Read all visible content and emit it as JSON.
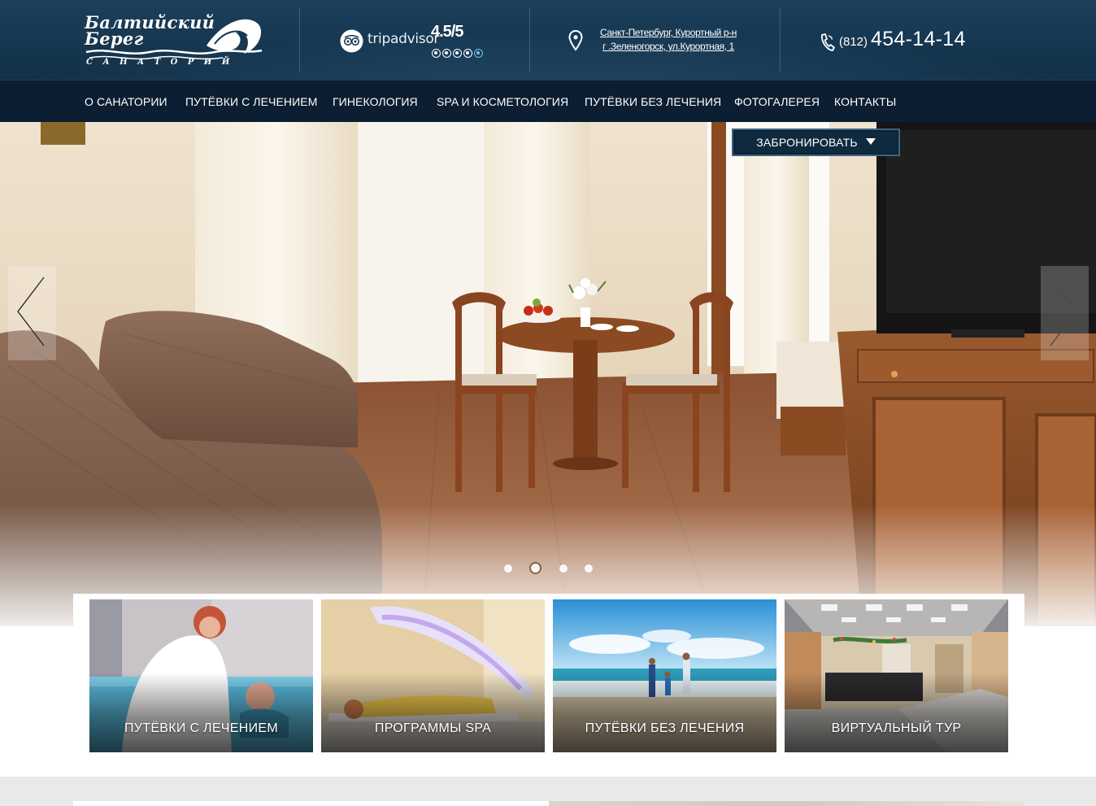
{
  "header": {
    "logo": {
      "title": "Балтийский Берег",
      "subtitle": "САНАТОРИЙ"
    },
    "tripadvisor": {
      "name": "tripadvisor",
      "rating": "4.5/5",
      "score": 4.5,
      "icon": "tripadvisor-owl-icon"
    },
    "address": {
      "line1": "Санкт-Петербург, Курортный р-н",
      "line2": "г .Зеленогорск, ул.Курортная, 1",
      "icon": "map-pin-icon"
    },
    "phone": {
      "code": "(812)",
      "number": "454-14-14",
      "icon": "phone-icon"
    }
  },
  "nav": {
    "items": [
      "О САНАТОРИИ",
      "ПУТЁВКИ С ЛЕЧЕНИЕМ",
      "ГИНЕКОЛОГИЯ",
      "SPA И КОСМЕТОЛОГИЯ",
      "ПУТЁВКИ БЕЗ ЛЕЧЕНИЯ",
      "ФОТОГАЛЕРЕЯ",
      "КОНТАКТЫ"
    ]
  },
  "hero": {
    "book_label": "ЗАБРОНИРОВАТЬ",
    "prev_icon": "chevron-left-icon",
    "next_icon": "chevron-right-icon",
    "slide_count": 4,
    "active_slide": 2
  },
  "cards": [
    {
      "label": "ПУТЁВКИ С ЛЕЧЕНИЕМ"
    },
    {
      "label": "ПРОГРАММЫ SPA"
    },
    {
      "label": "ПУТЁВКИ БЕЗ ЛЕЧЕНИЯ"
    },
    {
      "label": "ВИРТУАЛЬНЫЙ ТУР"
    }
  ],
  "colors": {
    "header_bg": "#163751",
    "nav_bg": "#0c1e31",
    "accent": "#6ec5e8",
    "text": "#ffffff"
  }
}
